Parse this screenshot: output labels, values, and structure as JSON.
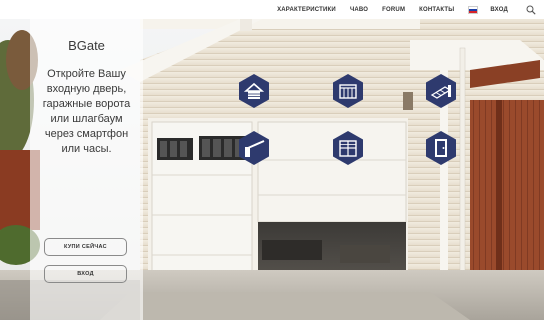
{
  "nav": {
    "items": [
      "ХАРАКТЕРИСТИКИ",
      "ЧАВО",
      "FORUM",
      "КОНТАКТЫ"
    ],
    "login": "ВХОД"
  },
  "panel": {
    "brand": "BGate",
    "tagline": "Откройте Вашу входную дверь, гаражные ворота или шлагбаум через смартфон или часы.",
    "buy_label": "КУПИ СЕЙЧАС",
    "login_label": "ВХОД"
  },
  "icons": [
    {
      "name": "garage-icon"
    },
    {
      "name": "gate-icon"
    },
    {
      "name": "sliding-gate-icon"
    },
    {
      "name": "barrier-icon"
    },
    {
      "name": "fence-gate-icon"
    },
    {
      "name": "door-icon"
    }
  ],
  "colors": {
    "hex_fill": "#2e3a6e",
    "hex_glyph": "#ffffff",
    "flag": [
      "#ffffff",
      "#1d3fa8",
      "#d8232a"
    ]
  }
}
